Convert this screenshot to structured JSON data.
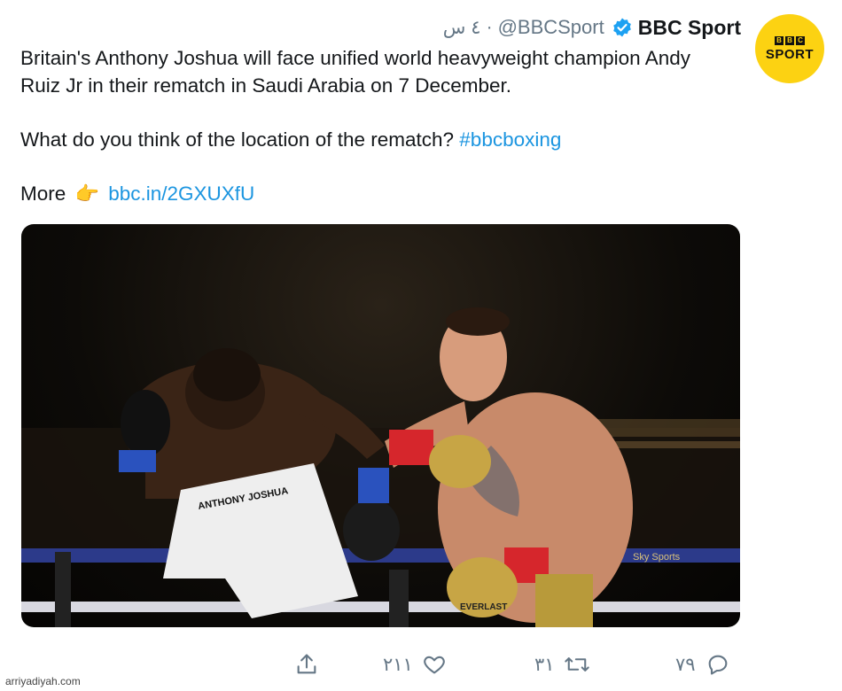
{
  "header": {
    "display_name": "BBC Sport",
    "handle": "@BBCSport",
    "separator": "·",
    "time": "٤ س"
  },
  "avatar": {
    "boxes": [
      "B",
      "B",
      "C"
    ],
    "word": "SPORT",
    "color": "#fcd212"
  },
  "tweet": {
    "line1": "Britain's Anthony Joshua will face unified world heavyweight champion Andy",
    "line2": "Ruiz Jr in their rematch in Saudi Arabia on 7 December.",
    "question": "What do you think of the location of the rematch? ",
    "hashtag": "#bbcboxing",
    "more_label": "More",
    "pointing_emoji": "👉",
    "link": "bbc.in/2GXUXfU"
  },
  "photo": {
    "description_icon": "boxing-photo",
    "trunks_text": "ANTHONY JOSHUA",
    "glove_text": "EVERLAST",
    "ring_banner": "Sky Sports"
  },
  "actions": {
    "replies": "٧٩",
    "retweets": "٣١",
    "likes": "٢١١"
  },
  "watermark": "arriyadiyah.com",
  "colors": {
    "link": "#1b95e0",
    "muted": "#657786",
    "verified": "#1da1f2"
  }
}
